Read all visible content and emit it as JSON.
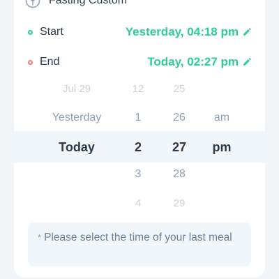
{
  "header": {
    "title": "Fasting  Custom",
    "icon": "fasting-icon"
  },
  "start": {
    "label": "Start",
    "value": "Yesterday, 04:18 pm",
    "dot_color": "#2ecc9a",
    "edit_icon": "pencil-icon"
  },
  "end": {
    "label": "End",
    "value": "Today, 02:27 pm",
    "dot_color": "#f07b7b",
    "edit_icon": "pencil-icon"
  },
  "picker": {
    "day": [
      "Jul 29",
      "Yesterday",
      "Today",
      "",
      ""
    ],
    "hour": [
      "12",
      "1",
      "2",
      "3",
      "4"
    ],
    "minute": [
      "25",
      "26",
      "27",
      "28",
      "29"
    ],
    "ampm": [
      "",
      "am",
      "pm",
      "",
      ""
    ],
    "selected_index": 2
  },
  "note": {
    "text": "Please select the time of your last meal",
    "star": "*"
  },
  "colors": {
    "accent": "#2ecc9a",
    "end_dot": "#f07b7b",
    "text_dark": "#2b3a4a",
    "muted": "#8fa0b1",
    "faint": "#c9d2da",
    "panel": "#f1f6fa"
  }
}
